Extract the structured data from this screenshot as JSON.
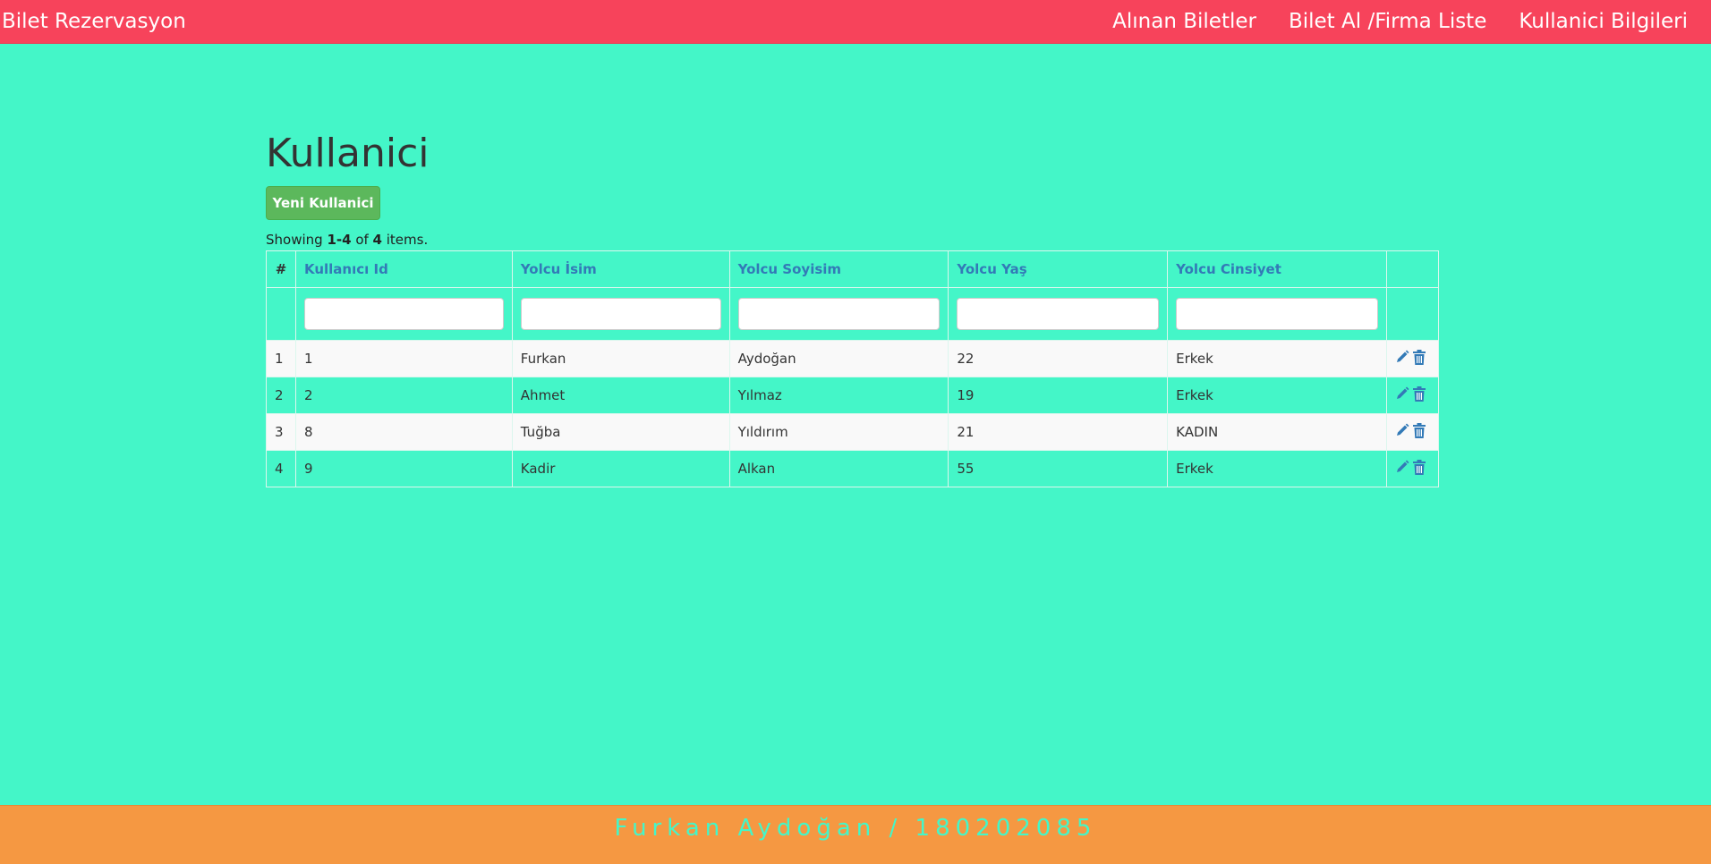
{
  "navbar": {
    "brand": "Bilet Rezervasyon",
    "links": [
      "Alınan Biletler",
      "Bilet Al /Firma Liste",
      "Kullanici Bilgileri"
    ]
  },
  "page": {
    "title": "Kullanici",
    "new_button": "Yeni Kullanici",
    "summary": {
      "prefix": "Showing ",
      "range": "1-4",
      "middle": " of ",
      "total": "4",
      "suffix": " items."
    }
  },
  "table": {
    "columns": [
      "#",
      "Kullanıcı Id",
      "Yolcu İsim",
      "Yolcu Soyisim",
      "Yolcu Yaş",
      "Yolcu Cinsiyet"
    ],
    "rows": [
      [
        "1",
        "1",
        "Furkan",
        "Aydoğan",
        "22",
        "Erkek"
      ],
      [
        "2",
        "2",
        "Ahmet",
        "Yılmaz",
        "19",
        "Erkek"
      ],
      [
        "3",
        "8",
        "Tuğba",
        "Yıldırım",
        "21",
        "KADIN"
      ],
      [
        "4",
        "9",
        "Kadir",
        "Alkan",
        "55",
        "Erkek"
      ]
    ],
    "row_actions": [
      "pencil-icon",
      "trash-icon"
    ]
  },
  "footer": {
    "text": "Furkan Aydoğan / 180202085"
  },
  "colors": {
    "navbar": "#f7435b",
    "background": "#44f6c8",
    "footer": "#f59842",
    "link": "#337ab7",
    "success": "#5cb85c"
  }
}
